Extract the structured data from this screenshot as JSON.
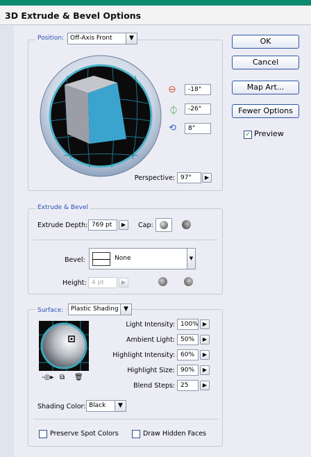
{
  "window": {
    "title": "3D Extrude & Bevel Options"
  },
  "position": {
    "legend": "Position:",
    "preset": "Off-Axis Front",
    "rot_x": "-18°",
    "rot_y": "-26°",
    "rot_z": "8°",
    "perspective_label": "Perspective:",
    "perspective": "97°"
  },
  "buttons": {
    "ok": "OK",
    "cancel": "Cancel",
    "map_art": "Map Art...",
    "fewer_options": "Fewer Options"
  },
  "preview": {
    "label": "Preview",
    "checked": true
  },
  "extrude": {
    "legend": "Extrude & Bevel",
    "depth_label": "Extrude Depth:",
    "depth": "769 pt",
    "cap_label": "Cap:",
    "bevel_label": "Bevel:",
    "bevel": "None",
    "height_label": "Height:",
    "height": "4 pt"
  },
  "surface": {
    "legend": "Surface:",
    "type": "Plastic Shading",
    "light_intensity_label": "Light Intensity:",
    "light_intensity": "100%",
    "ambient_light_label": "Ambient Light:",
    "ambient_light": "50%",
    "highlight_intensity_label": "Highlight Intensity:",
    "highlight_intensity": "60%",
    "highlight_size_label": "Highlight Size:",
    "highlight_size": "90%",
    "blend_steps_label": "Blend Steps:",
    "blend_steps": "25",
    "shading_color_label": "Shading Color:",
    "shading_color": "Black"
  },
  "options": {
    "preserve_spot": "Preserve Spot Colors",
    "draw_hidden": "Draw Hidden Faces"
  },
  "colors": {
    "accent": "#2a4fb3",
    "cube_front": "#3aa4cf",
    "ring": "#3fa5b8",
    "title_bar_top": "#0e8a6e"
  }
}
